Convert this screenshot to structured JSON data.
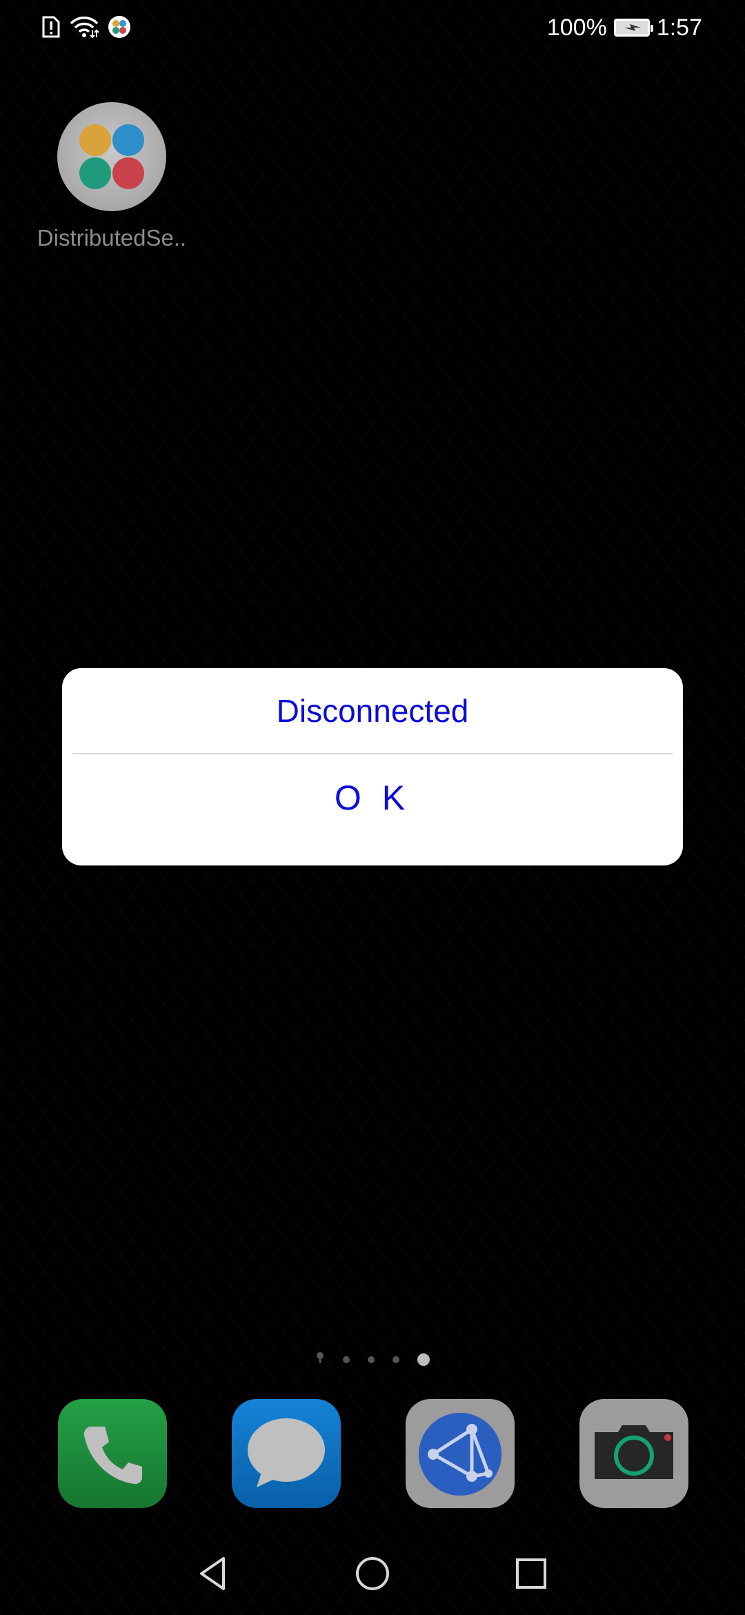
{
  "status_bar": {
    "battery_percent": "100%",
    "time": "1:57",
    "icons": [
      "sim-alert-icon",
      "wifi-icon",
      "distributed-app-notification-icon",
      "battery-charging-icon"
    ]
  },
  "desktop": {
    "app": {
      "label": "DistributedSe..",
      "icon": "distributed-app-icon",
      "colors": [
        "#d9a23a",
        "#2e8fc9",
        "#1f9a7a",
        "#c9414b"
      ]
    }
  },
  "dialog": {
    "title": "Disconnected",
    "button_label": "O K",
    "accent_color": "#0b0bdc"
  },
  "page_indicator": {
    "pages": 5,
    "active_page": 5
  },
  "dock": {
    "apps": [
      {
        "name": "Phone",
        "icon": "phone-icon",
        "color": "#1e8a3c"
      },
      {
        "name": "Messages",
        "icon": "message-icon",
        "color": "#0a68b5"
      },
      {
        "name": "Browser",
        "icon": "browser-icon",
        "color": "#9c9c9c"
      },
      {
        "name": "Camera",
        "icon": "camera-icon",
        "color": "#9c9c9c"
      }
    ]
  },
  "nav_bar": {
    "buttons": [
      "back",
      "home",
      "recents"
    ]
  }
}
